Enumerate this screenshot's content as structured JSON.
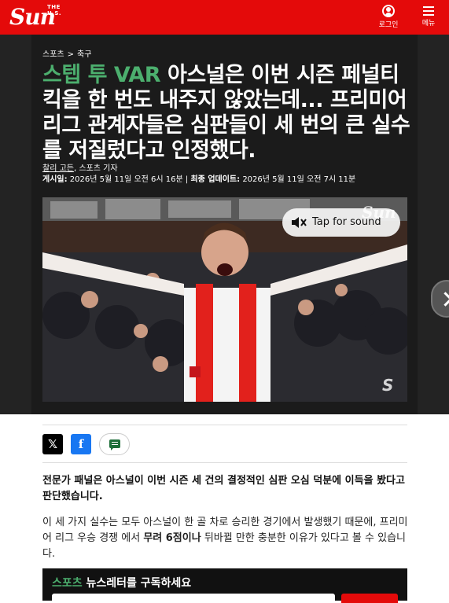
{
  "header": {
    "logo_small": "THE U.S.",
    "logo_main": "Sun",
    "login_label": "로그인",
    "menu_label": "메뉴"
  },
  "breadcrumb": {
    "items": [
      "스포츠",
      "축구"
    ],
    "separator": ">"
  },
  "article": {
    "headline_accent": "스텝 투 VAR",
    "headline_rest": " 아스널은 이번 시즌 페널티 킥을 한 번도 내주지 않았는데... 프리미어리그 관계자들은 심판들이 세 번의 큰 실수를 저질렀다고 인정했다.",
    "author": "찰리 고든",
    "author_role": ", 스포츠 기자",
    "published_label": "게시일:",
    "published_value": " 2026년 5월 11일 오전 6시 16분",
    "divider": " | ",
    "updated_label": "최종 업데이트:",
    "updated_value": " 2026년 5월 11일 오전 7시 11분",
    "lede": "전문가 패널은 아스널이 이번 시즌 세 건의 결정적인 심판 오심 덕분에 이득을 봤다고 판단했습니다.",
    "para_part1": "이 세 가지 실수는 모두 아스널이 한 골 차로 승리한 경기에서 발생했기 때문에, 프리미어 리그 우승 경쟁 에서 ",
    "para_highlight": "무려 6점이나",
    "para_part2": " 뒤바뀔 만한 충분한 이유가 있다고 볼 수 있습니다."
  },
  "video": {
    "sound_label": "Tap for sound",
    "watermark": "Sun",
    "corner_mark": "S"
  },
  "share": {
    "x_label": "𝕏",
    "facebook_label": "f"
  },
  "newsletter": {
    "accent": "스포츠",
    "title_rest": " 뉴스레터를 구독하세요"
  },
  "colors": {
    "brand_red": "#e40a0a",
    "accent_green": "#4caf6e",
    "dark_bg": "#1b1b1b"
  }
}
